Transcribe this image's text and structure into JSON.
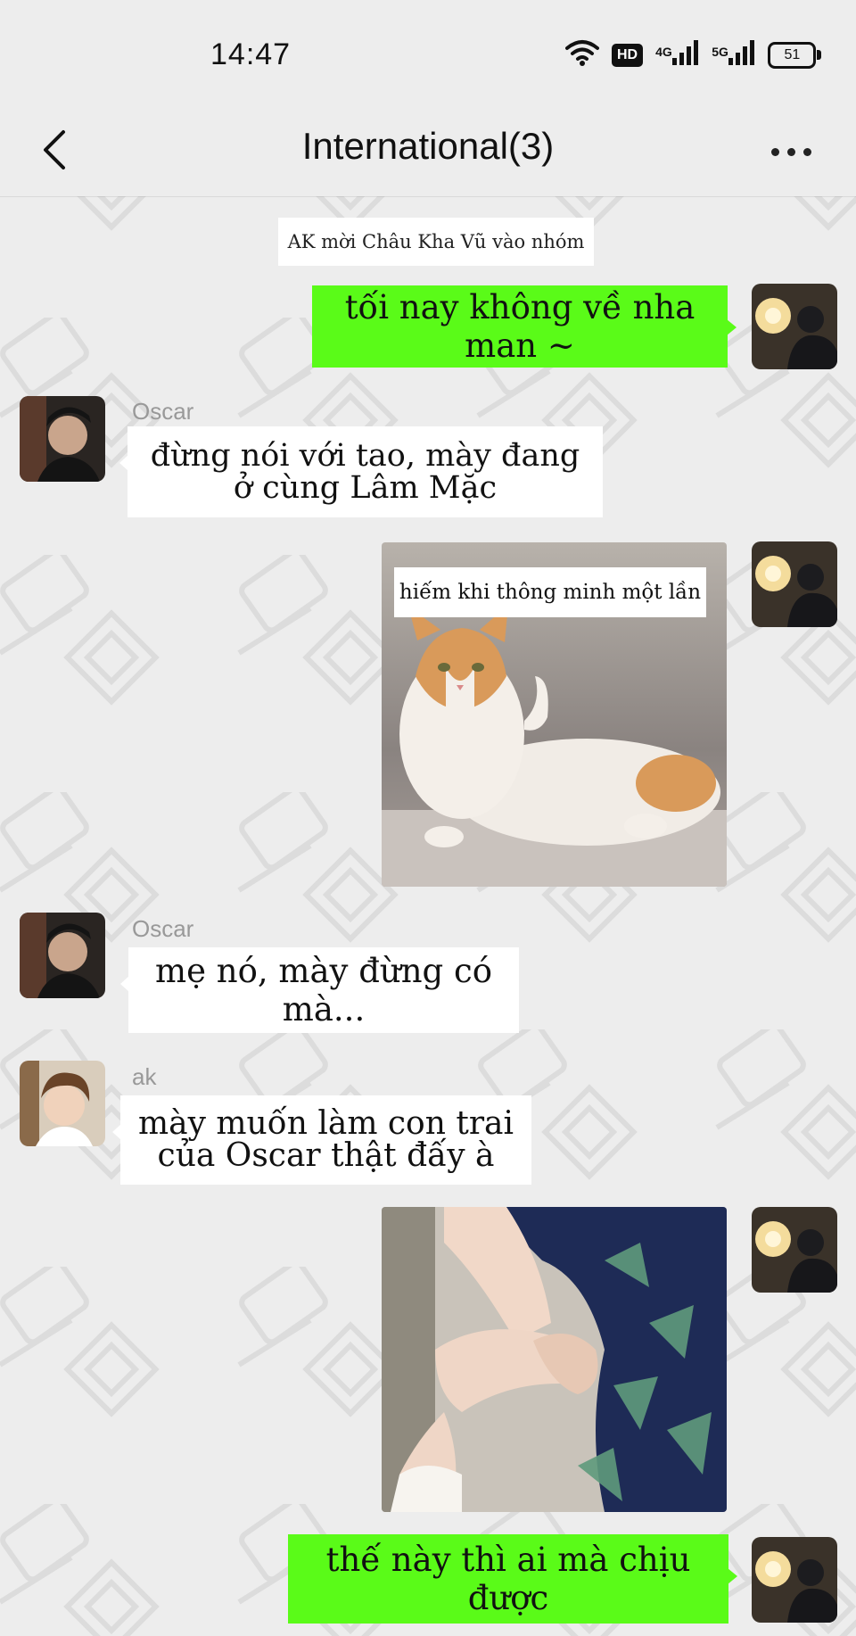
{
  "status": {
    "time": "14:47",
    "hd_label": "HD",
    "net_4g": "4G",
    "net_5g": "5G",
    "battery": "51"
  },
  "header": {
    "title": "International(3)"
  },
  "system_notice": "AK mời Châu Kha Vũ vào nhóm",
  "messages": {
    "m1": {
      "text": "tối nay không về nha man ~"
    },
    "m2": {
      "sender": "Oscar",
      "text": "đừng nói với tao, mày đang ở cùng Lâm Mặc"
    },
    "m3": {
      "caption": "hiếm khi thông minh một lần"
    },
    "m4": {
      "sender": "Oscar",
      "text": "mẹ nó, mày đừng có mà..."
    },
    "m5": {
      "sender": "ak",
      "text": "mày muốn làm con trai của Oscar thật đấy à"
    },
    "m7": {
      "text": "thế này thì ai mà chịu được"
    }
  },
  "colors": {
    "background": "#ededed",
    "sent_bubble": "#5afb18",
    "received_bubble": "#ffffff"
  }
}
